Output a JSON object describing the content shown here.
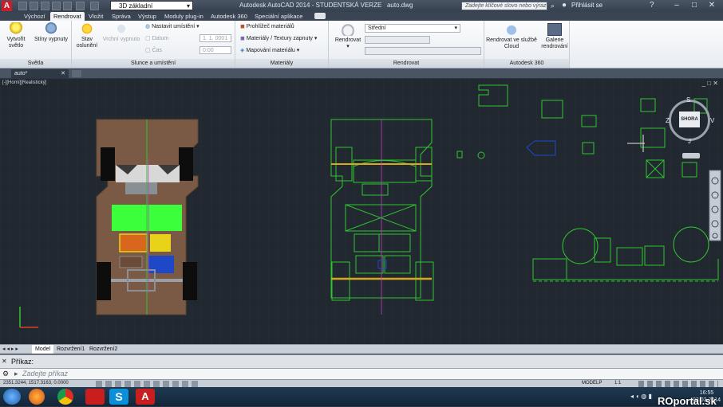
{
  "app": {
    "title": "Autodesk AutoCAD 2014 - STUDENTSKÁ VERZE",
    "file": "auto.dwg",
    "workspace": "3D základní",
    "search_placeholder": "Zadejte klíčové slovo nebo výraz",
    "login": "Přihlásit se"
  },
  "menu_tabs": [
    "Výchozí",
    "Rendrovat",
    "Vložit",
    "Správa",
    "Výstup",
    "Moduly plug-in",
    "Autodesk 360",
    "Speciální aplikace"
  ],
  "active_tab": "Rendrovat",
  "ribbon": {
    "svetla": {
      "title": "Světla",
      "create_light": "Vytvořit světlo",
      "shadows": "Stíny vypnuty"
    },
    "slunce": {
      "title": "Slunce a umístění",
      "sun_status": "Stav oslunění",
      "sky": "Vrchní vypnuto",
      "location": "Nastavit umístění",
      "date_label": "Datum",
      "date_value": "1. 1. 0001",
      "time_label": "Čas",
      "time_value": "0:00"
    },
    "materialy": {
      "title": "Materiály",
      "browser": "Prohlížeč materiálů",
      "textures": "Materiály / Textury zapnuty",
      "mapping": "Mapování materiálu"
    },
    "rendrovat": {
      "title": "Rendrovat",
      "render_btn": "Rendrovat",
      "quality": "Střední"
    },
    "a360": {
      "title": "Autodesk 360",
      "cloud": "Rendrovat ve službě Cloud",
      "gallery": "Galerie rendrování"
    }
  },
  "doc_tab": "auto*",
  "viewport_label": "[-][Horní][Realistický]",
  "viewcube": {
    "top": "S",
    "bottom": "J",
    "left": "Z",
    "right": "V",
    "face": "SHORA"
  },
  "layout_tabs": [
    "Model",
    "Rozvržení1",
    "Rozvržení2"
  ],
  "command": {
    "label": "Příkaz:",
    "placeholder": "Zadejte příkaz"
  },
  "status": {
    "coords": "2351.3244, 1517.3163, 0.0000",
    "mode": "MODELP",
    "scale": "1:1"
  },
  "taskbar": {
    "time": "16:55",
    "date": "03.03.2014"
  },
  "watermark": "ROportal.sk",
  "colors": {
    "floor": "#7a5a45",
    "green": "#2fc52f",
    "body_green": "#3cff3c",
    "orange": "#d8661c",
    "yellow": "#e8d21a",
    "blue": "#1f48c8",
    "bg": "#212830"
  }
}
